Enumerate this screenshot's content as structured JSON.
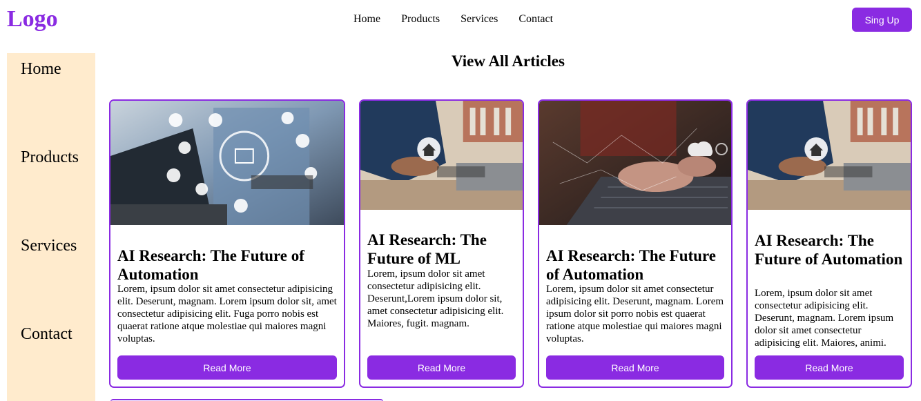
{
  "header": {
    "logo": "Logo",
    "nav": [
      "Home",
      "Products",
      "Services",
      "Contact"
    ],
    "signup_label": "Sing Up"
  },
  "sidebar": {
    "items": [
      "Home",
      "Products",
      "Services",
      "Contact"
    ]
  },
  "main": {
    "title": "View All Articles",
    "cards": [
      {
        "title": "AI Research: The Future of Automation",
        "body": "Lorem, ipsum dolor sit amet consectetur adipisicing elit. Deserunt, magnam. Lorem ipsum dolor sit, amet consectetur adipisicing elit. Fuga porro nobis est quaerat ratione atque molestiae qui maiores magni voluptas.",
        "button": "Read More",
        "image_icon": "dollar-network-icon"
      },
      {
        "title": "AI Research: The Future of ML",
        "body": "Lorem, ipsum dolor sit amet consectetur adipisicing elit. Deserunt,Lorem ipsum dolor sit, amet consectetur adipisicing elit. Maiores, fugit. magnam.",
        "button": "Read More",
        "image_icon": "smart-home-icon"
      },
      {
        "title": "AI Research: The Future of Automation",
        "body": "Lorem, ipsum dolor sit amet consectetur adipisicing elit. Deserunt, magnam. Lorem ipsum dolor sit porro nobis est quaerat ratione atque molestiae qui maiores magni voluptas.",
        "button": "Read More",
        "image_icon": "cloud-keyboard-icon"
      },
      {
        "title": "AI Research: The Future of Automation",
        "body": "Lorem, ipsum dolor sit amet consectetur adipisicing elit. Deserunt, magnam. Lorem ipsum dolor sit amet consectetur adipisicing elit. Maiores, animi.",
        "button": "Read More",
        "image_icon": "smart-home-icon"
      }
    ]
  },
  "colors": {
    "accent": "#8a2be2",
    "sidebar_bg": "#ffebcd"
  }
}
